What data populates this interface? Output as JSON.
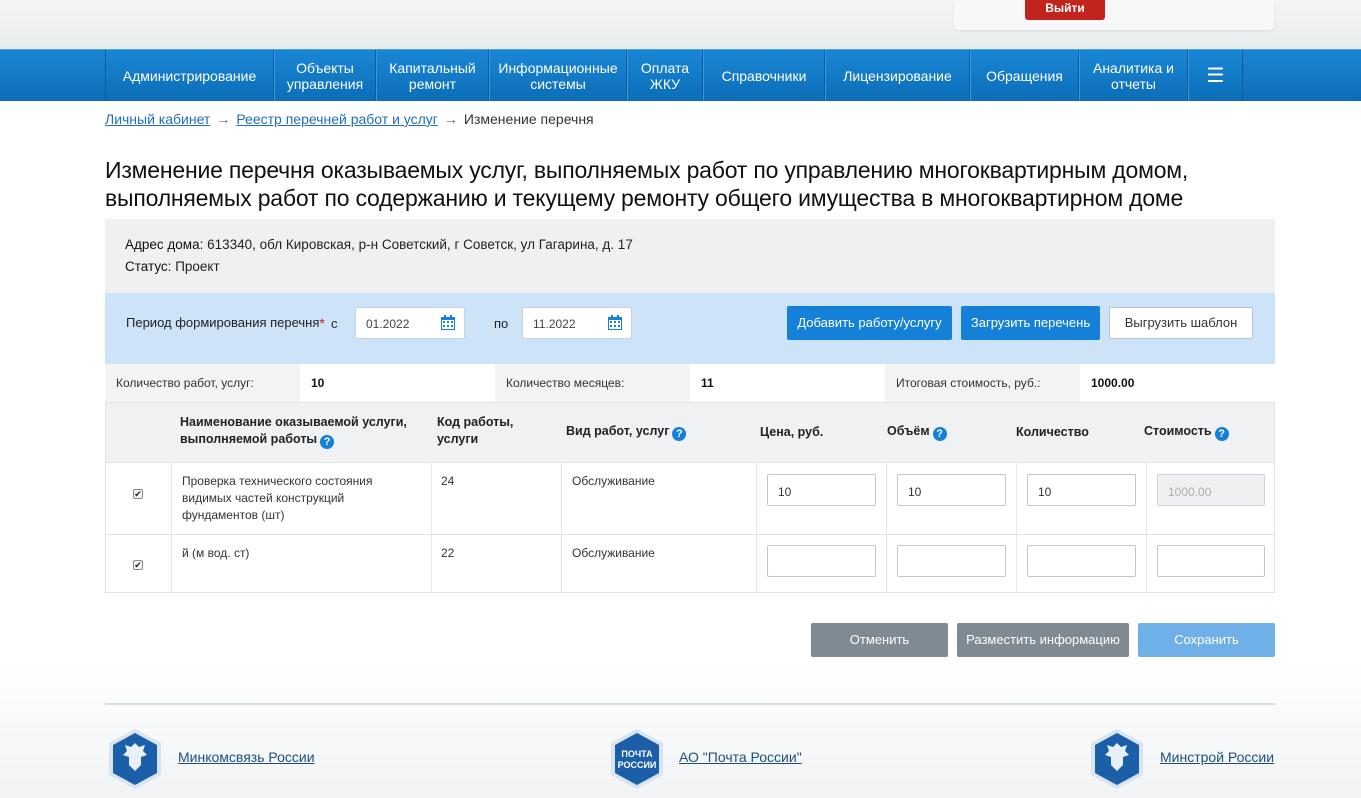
{
  "header": {
    "logout_label": "Выйти"
  },
  "nav": {
    "items": [
      {
        "label": "Администрирование"
      },
      {
        "label": "Объекты управления"
      },
      {
        "label": "Капитальный ремонт"
      },
      {
        "label": "Информационные системы"
      },
      {
        "label": "Оплата ЖКУ"
      },
      {
        "label": "Справочники"
      },
      {
        "label": "Лицензирование"
      },
      {
        "label": "Обращения"
      },
      {
        "label": "Аналитика и отчеты"
      }
    ],
    "menu_icon": "☰"
  },
  "breadcrumb": {
    "items": [
      "Личный кабинет",
      "Реестр перечней работ и услуг"
    ],
    "current": "Изменение перечня",
    "arrow": "→"
  },
  "page_title": "Изменение перечня оказываемых услуг, выполняемых работ по управлению многоквартирным домом, выполняемых работ по содержанию и текущему ремонту общего имущества в многоквартирном доме",
  "info": {
    "address_label": "Адрес дома:",
    "address_value": "613340, обл Кировская, р-н Советский, г Советск, ул Гагарина, д. 17",
    "status_label": "Статус:",
    "status_value": "Проект"
  },
  "period": {
    "label": "Период формирования перечня",
    "required_mark": "*",
    "from_label": "с",
    "from_value": "01.2022",
    "to_label": "по",
    "to_value": "11.2022",
    "add_button": "Добавить работу/услугу",
    "upload_button": "Загрузить перечень",
    "template_button": "Выгрузить шаблон"
  },
  "summary": {
    "count_label": "Количество работ, услуг:",
    "count_value": "10",
    "months_label": "Количество месяцев:",
    "months_value": "11",
    "total_label": "Итоговая стоимость, руб.:",
    "total_value": "1000.00"
  },
  "table": {
    "headers": {
      "name": "Наименование оказываемой услуги, выполняемой работы",
      "code": "Код работы, услуги",
      "type": "Вид работ, услуг",
      "price": "Цена, руб.",
      "volume": "Объём",
      "quantity": "Количество",
      "cost": "Стоимость"
    },
    "help_icon": "?",
    "rows": [
      {
        "checked": "✔",
        "name": "Проверка технического состояния видимых частей конструкций фундаментов (шт)",
        "code": "24",
        "type": "Обслуживание",
        "price": "10",
        "volume": "10",
        "quantity": "10",
        "cost": "1000.00"
      },
      {
        "checked": "✔",
        "name": "й (м вод. ст)",
        "code": "22",
        "type": "Обслуживание",
        "price": "",
        "volume": "",
        "quantity": "",
        "cost": ""
      }
    ]
  },
  "actions": {
    "cancel": "Отменить",
    "publish": "Разместить информацию",
    "save": "Сохранить"
  },
  "footer": {
    "links": [
      "Минкомсвязь России",
      "АО \"Почта России\"",
      "Минстрой России"
    ],
    "pochta_logo_text": [
      "ПОЧТА",
      "РОССИИ"
    ]
  },
  "colors": {
    "nav_blue": "#0b6db8",
    "primary_button": "#1580d8",
    "logout_red": "#c0241d",
    "panel_blue": "#cde3f7",
    "cancel_grey": "#7f8a93",
    "save_disabled": "#6fb0e8"
  }
}
